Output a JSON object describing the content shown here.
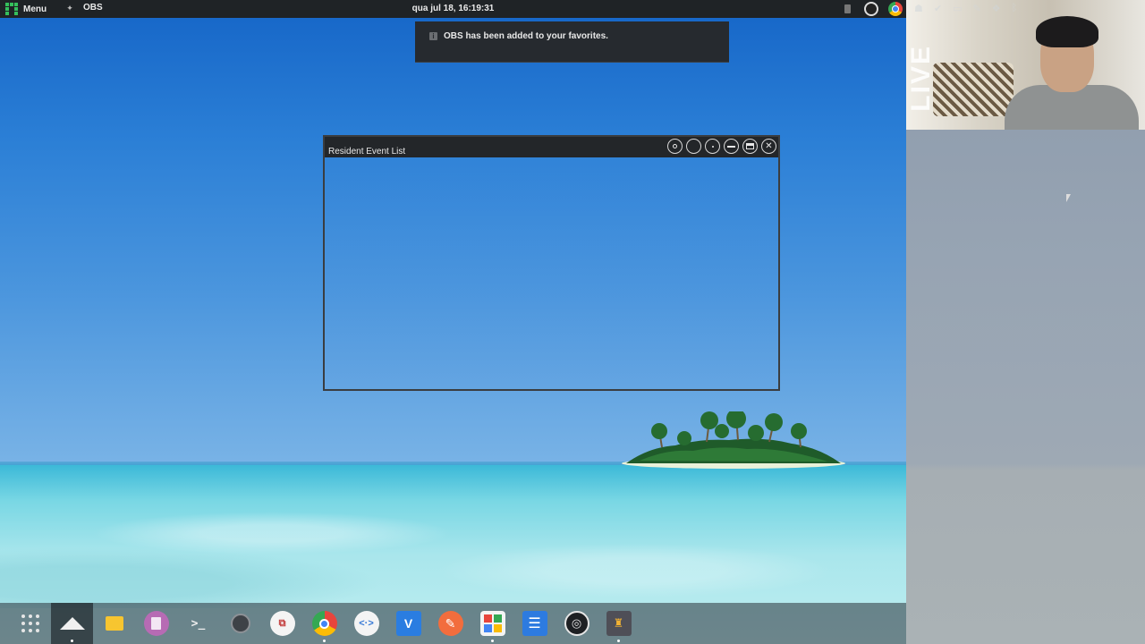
{
  "top_panel": {
    "menu_label": "Menu",
    "app_label": "OBS",
    "clock": "qua jul 18, 16:19:31"
  },
  "notification": {
    "message": "OBS has been added to your favorites.",
    "icon": "info-icon"
  },
  "event_window": {
    "title": "Resident Event List",
    "controls": [
      "record-icon",
      "circle-icon",
      "dot-icon",
      "minimize-icon",
      "maximize-icon",
      "close-icon"
    ]
  },
  "webcam": {
    "overlay_text": "LIVE"
  },
  "dock": {
    "items": [
      {
        "name": "apps-grid",
        "icon": "apps-grid-icon"
      },
      {
        "name": "show-desktop",
        "icon": "up-arrow-icon"
      },
      {
        "name": "files",
        "icon": "folder-icon"
      },
      {
        "name": "notes",
        "icon": "notes-icon"
      },
      {
        "name": "terminal",
        "icon": "terminal-icon"
      },
      {
        "name": "obs",
        "icon": "obs-icon"
      },
      {
        "name": "remote-desktop",
        "icon": "remote-desktop-icon"
      },
      {
        "name": "chrome",
        "icon": "chrome-icon"
      },
      {
        "name": "code-editor",
        "icon": "code-icon"
      },
      {
        "name": "vscode",
        "icon": "vscode-icon"
      },
      {
        "name": "feather",
        "icon": "feather-icon"
      },
      {
        "name": "software-center",
        "icon": "grid-icon"
      },
      {
        "name": "document-viewer",
        "icon": "document-icon"
      },
      {
        "name": "obs-studio",
        "icon": "obs-studio-icon"
      },
      {
        "name": "game",
        "icon": "game-icon"
      }
    ]
  },
  "colors": {
    "panel_bg": "#1f2326",
    "accent_green": "#35bf5c",
    "sky_blue": "#2b7fd6",
    "sea_turquoise": "#79d7e4"
  }
}
